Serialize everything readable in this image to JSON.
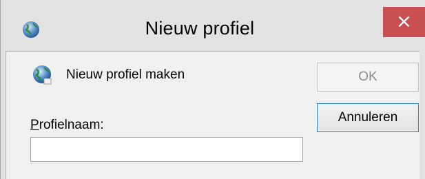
{
  "window": {
    "title": "Nieuw profiel",
    "close_glyph": "×",
    "title_icon": "globe-icon",
    "accent_close": "#c74f50"
  },
  "dialog": {
    "header_icon": "profile-globe-icon",
    "header_text": "Nieuw profiel maken",
    "name_label_accel": "P",
    "name_label_rest": "rofielnaam:",
    "name_value": "",
    "ok_label": "OK",
    "cancel_label": "Annuleren"
  }
}
